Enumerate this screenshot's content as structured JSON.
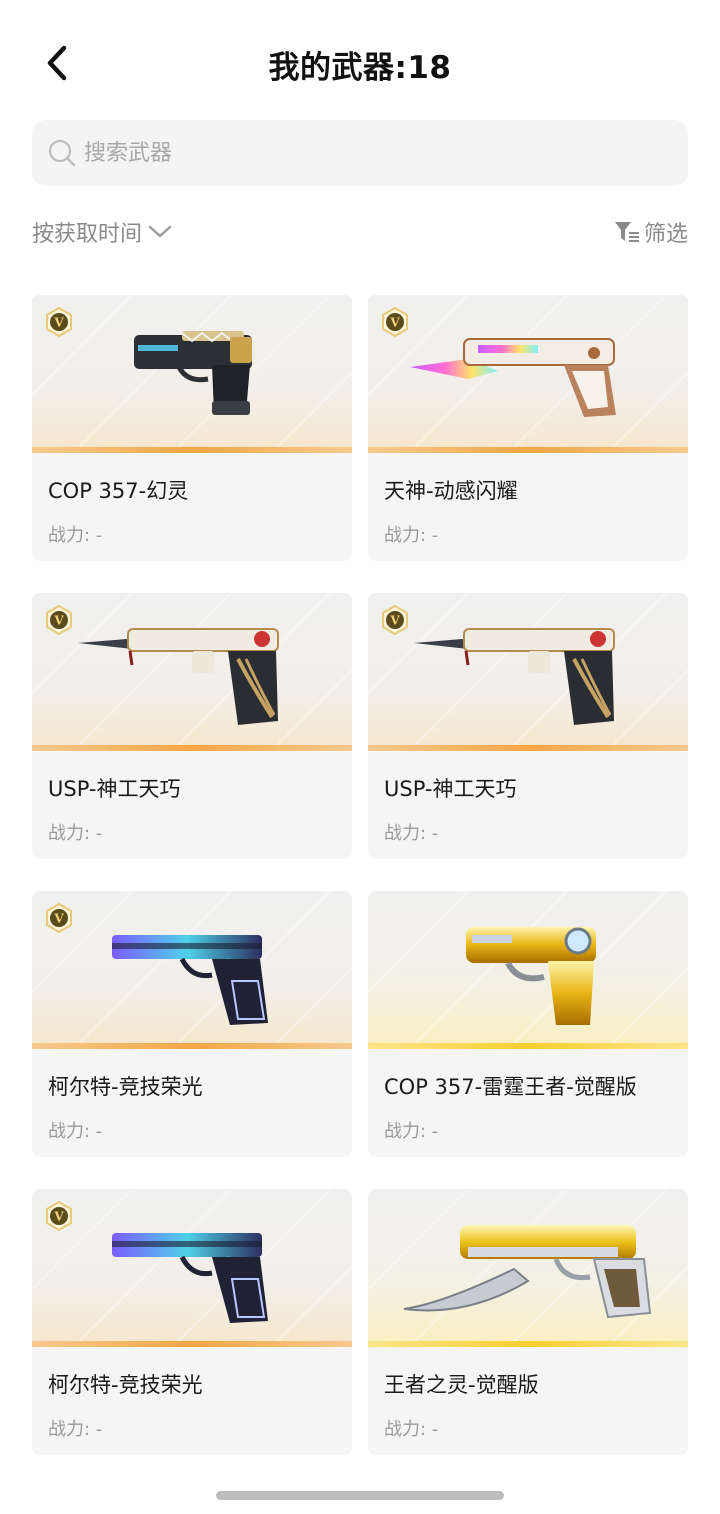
{
  "header": {
    "title": "我的武器:18"
  },
  "search": {
    "placeholder": "搜索武器"
  },
  "sort": {
    "label": "按获取时间"
  },
  "filter": {
    "label": "筛选"
  },
  "weapons": [
    {
      "name": "COP 357-幻灵",
      "power": "战力: -",
      "badge": true,
      "style": "orange"
    },
    {
      "name": "天神-动感闪耀",
      "power": "战力: -",
      "badge": true,
      "style": "orange"
    },
    {
      "name": "USP-神工天巧",
      "power": "战力: -",
      "badge": true,
      "style": "orange"
    },
    {
      "name": "USP-神工天巧",
      "power": "战力: -",
      "badge": true,
      "style": "orange"
    },
    {
      "name": "柯尔特-竞技荣光",
      "power": "战力: -",
      "badge": true,
      "style": "orange"
    },
    {
      "name": "COP 357-雷霆王者-觉醒版",
      "power": "战力: -",
      "badge": false,
      "style": "gold"
    },
    {
      "name": "柯尔特-竞技荣光",
      "power": "战力: -",
      "badge": true,
      "style": "orange"
    },
    {
      "name": "王者之灵-觉醒版",
      "power": "战力: -",
      "badge": false,
      "style": "gold"
    }
  ]
}
